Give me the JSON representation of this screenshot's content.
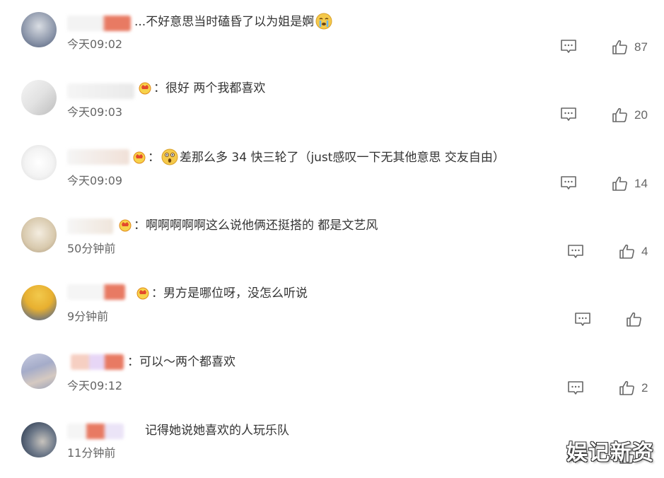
{
  "comments": [
    {
      "text": "...不好意思当时磕昏了以为姐是婀",
      "time": "今天09:02",
      "likes": "87",
      "badge": false,
      "emoji": "crying"
    },
    {
      "text": "：很好 两个我都喜欢",
      "time": "今天09:03",
      "likes": "20",
      "badge": true
    },
    {
      "text": "差那么多 34 快三轮了（just感叹一下无其他意思 交友自由）",
      "time": "今天09:09",
      "likes": "14",
      "badge": true,
      "emoji": "shocked"
    },
    {
      "text": "：啊啊啊啊啊这么说他俩还挺搭的 都是文艺风",
      "time": "50分钟前",
      "likes": "4",
      "badge": true
    },
    {
      "text": "：男方是哪位呀，没怎么听说",
      "time": "9分钟前",
      "likes": "",
      "badge": true
    },
    {
      "text": "：可以～两个都喜欢",
      "time": "今天09:12",
      "likes": "2",
      "badge": false
    },
    {
      "text": "记得她说她喜欢的人玩乐队",
      "time": "11分钟前",
      "likes": "",
      "badge": false
    }
  ],
  "watermark": "娱记新资"
}
